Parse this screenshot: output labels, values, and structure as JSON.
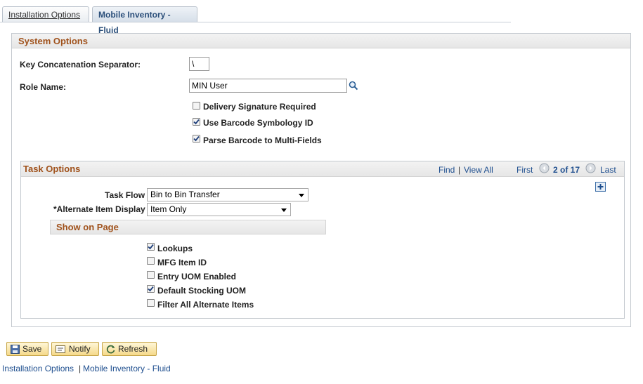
{
  "tabs": [
    {
      "label": "Installation Options"
    },
    {
      "label": "Mobile Inventory - Fluid"
    }
  ],
  "system_options": {
    "title": "System Options",
    "key_separator_label": "Key Concatenation Separator:",
    "key_separator_value": "\\",
    "role_name_label": "Role Name:",
    "role_name_value": "MIN User",
    "checkboxes": [
      {
        "label": "Delivery Signature Required",
        "checked": false
      },
      {
        "label": "Use Barcode Symbology ID",
        "checked": true
      },
      {
        "label": "Parse Barcode to Multi-Fields",
        "checked": true
      }
    ]
  },
  "task_options": {
    "title": "Task Options",
    "find": "Find",
    "view_all": "View All",
    "first": "First",
    "counter": "2 of 17",
    "last": "Last",
    "task_flow_label": "Task Flow",
    "task_flow_value": "Bin to Bin Transfer",
    "alt_item_label": "*Alternate Item Display",
    "alt_item_value": "Item Only",
    "show_on_page": {
      "title": "Show on Page",
      "checkboxes": [
        {
          "label": "Lookups",
          "checked": true
        },
        {
          "label": "MFG Item ID",
          "checked": false
        },
        {
          "label": "Entry UOM Enabled",
          "checked": false
        },
        {
          "label": "Default Stocking UOM",
          "checked": true
        },
        {
          "label": "Filter All Alternate Items",
          "checked": false
        }
      ]
    }
  },
  "toolbar": {
    "save": "Save",
    "notify": "Notify",
    "refresh": "Refresh"
  },
  "footer_links": {
    "installation_options": "Installation Options",
    "separator": "|",
    "mobile_inventory": "Mobile Inventory - Fluid"
  },
  "colors": {
    "section_title": "#a0521c",
    "link": "#1f4f8f",
    "button_bg": "#f5d98a"
  }
}
